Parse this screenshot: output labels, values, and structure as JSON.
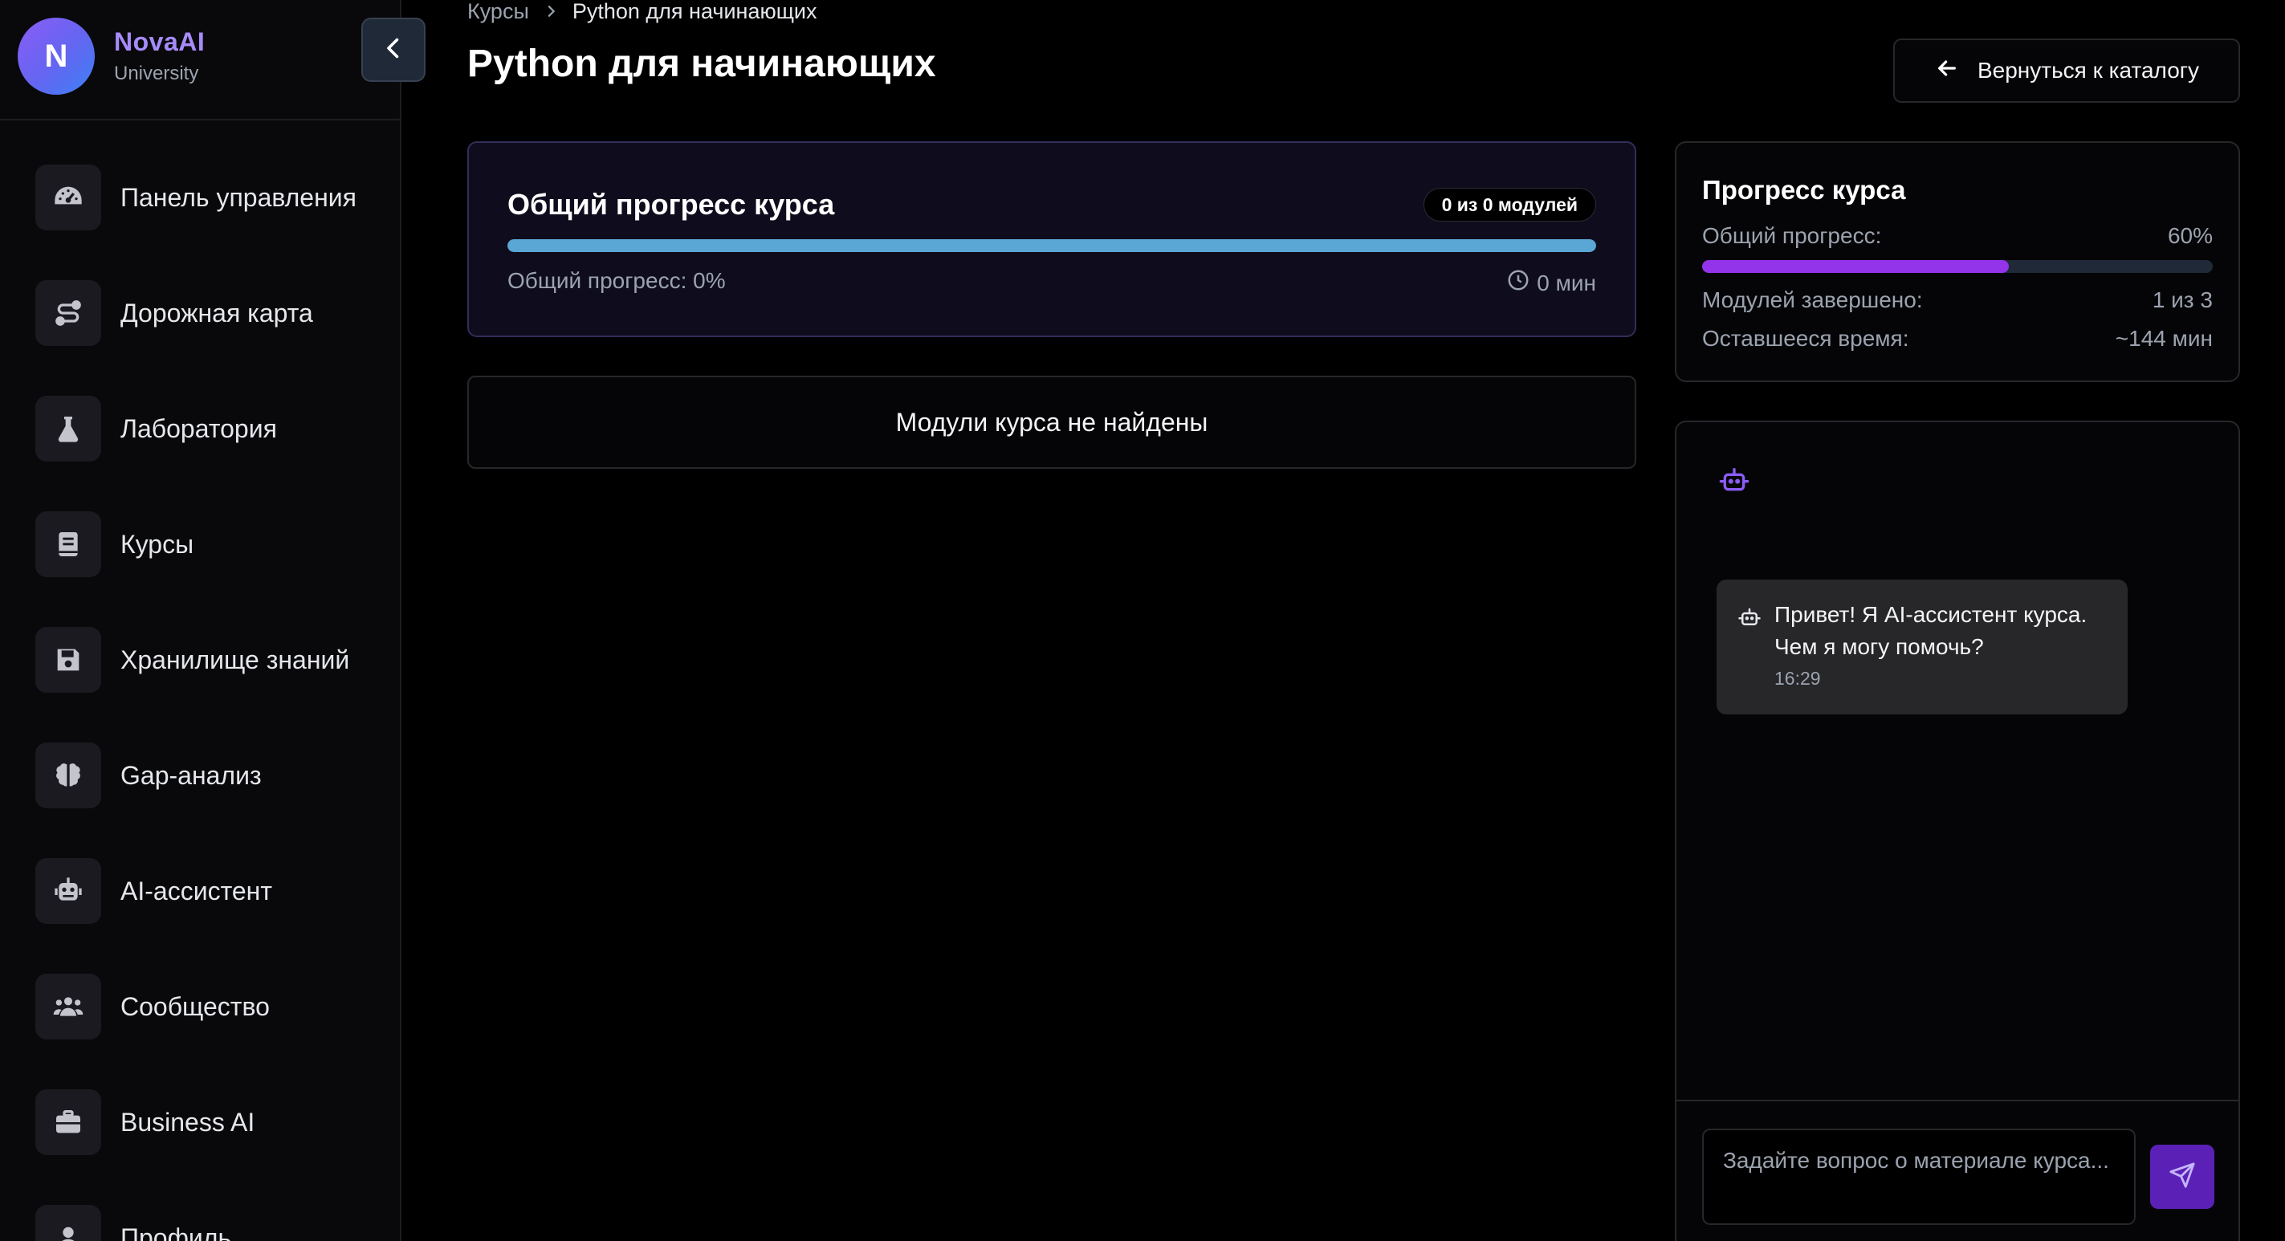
{
  "brand": {
    "avatar_letter": "N",
    "name": "NovaAI",
    "subtitle": "University"
  },
  "sidebar": {
    "items": [
      {
        "label": "Панель управления",
        "icon": "gauge-icon"
      },
      {
        "label": "Дорожная карта",
        "icon": "route-icon"
      },
      {
        "label": "Лаборатория",
        "icon": "flask-icon"
      },
      {
        "label": "Курсы",
        "icon": "book-icon"
      },
      {
        "label": "Хранилище знаний",
        "icon": "save-icon"
      },
      {
        "label": "Gap-анализ",
        "icon": "brain-icon"
      },
      {
        "label": "AI-ассистент",
        "icon": "robot-icon"
      },
      {
        "label": "Сообщество",
        "icon": "users-icon"
      },
      {
        "label": "Business AI",
        "icon": "briefcase-icon"
      },
      {
        "label": "Профиль",
        "icon": "user-icon"
      }
    ]
  },
  "breadcrumb": {
    "parent": "Курсы",
    "current": "Python для начинающих"
  },
  "page": {
    "title": "Python для начинающих",
    "back_label": "Вернуться к каталогу"
  },
  "course_progress": {
    "title": "Общий прогресс курса",
    "badge": "0 из 0 модулей",
    "progress_text": "Общий прогресс: 0%",
    "time": "0 мин",
    "bar_color": "#5aa6d4"
  },
  "empty_state": {
    "text": "Модули курса не найдены"
  },
  "stats": {
    "title": "Прогресс курса",
    "overall_label": "Общий прогресс:",
    "overall_value": "60%",
    "overall_fraction": 0.6,
    "modules_label": "Модулей завершено:",
    "modules_value": "1 из 3",
    "remaining_label": "Оставшееся время:",
    "remaining_value": "~144 мин",
    "bar_color": "#9333ea"
  },
  "chat": {
    "message": "Привет! Я AI-ассистент курса. Чем я могу помочь?",
    "time": "16:29",
    "input_placeholder": "Задайте вопрос о материале курса..."
  },
  "colors": {
    "accent": "#a78bfa",
    "primary": "#7c3aed",
    "background": "#000000"
  }
}
